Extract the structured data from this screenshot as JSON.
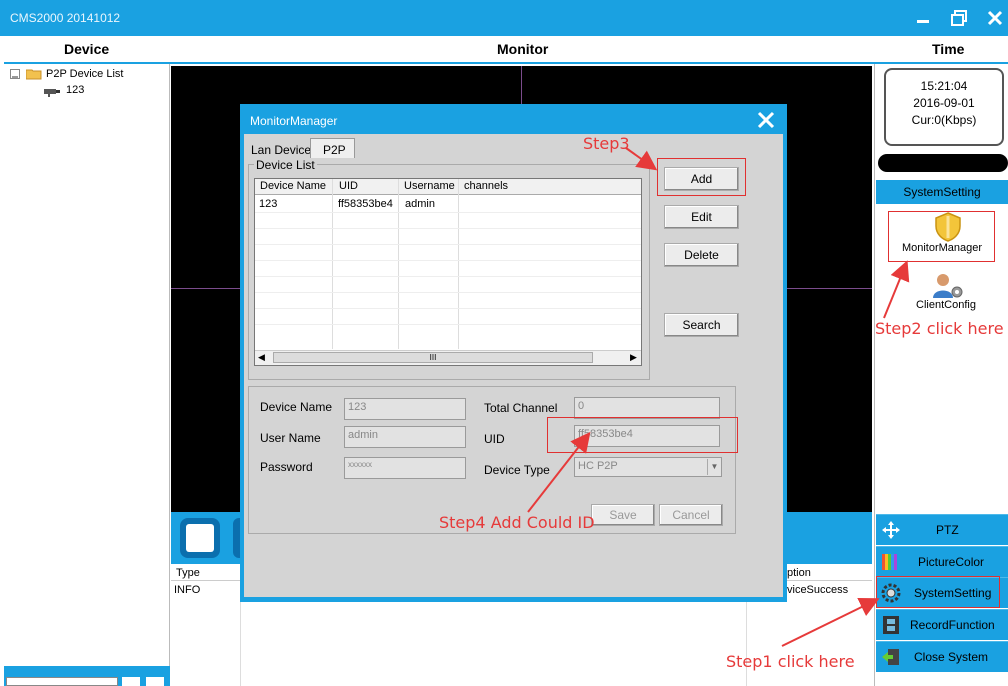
{
  "window": {
    "title": "CMS2000 20141012"
  },
  "columns": {
    "device": "Device",
    "monitor": "Monitor",
    "time": "Time"
  },
  "tree": {
    "root": "P2P Device List",
    "child": "123"
  },
  "time_panel": {
    "time": "15:21:04",
    "date": "2016-09-01",
    "rate": "Cur:0(Kbps)"
  },
  "right": {
    "system_setting_header": "SystemSetting",
    "monitor_manager": "MonitorManager",
    "client_config": "ClientConfig",
    "menu": [
      "PTZ",
      "PictureColor",
      "SystemSetting",
      "RecordFunction",
      "Close System"
    ]
  },
  "log": {
    "col_type": "Type",
    "col_description": "ption",
    "row_type": "INFO",
    "row_description": "viceSuccess"
  },
  "dialog": {
    "title": "MonitorManager",
    "tabs": [
      "Lan Device",
      "P2P"
    ],
    "group_label": "Device List",
    "table_headers": [
      "Device Name",
      "UID",
      "Username",
      "channels"
    ],
    "rows": [
      {
        "name": "123",
        "uid": "ff58353be4",
        "username": "admin",
        "channels": ""
      }
    ],
    "scroll_thumb": "III",
    "buttons": {
      "add": "Add",
      "edit": "Edit",
      "delete": "Delete",
      "search": "Search",
      "save": "Save",
      "cancel": "Cancel"
    },
    "form": {
      "device_name_label": "Device Name",
      "device_name": "123",
      "user_name_label": "User Name",
      "user_name": "admin",
      "password_label": "Password",
      "password": "xxxxxx",
      "total_channel_label": "Total Channel",
      "total_channel": "0",
      "uid_label": "UID",
      "uid": "ff58353be4",
      "device_type_label": "Device Type",
      "device_type": "HC P2P"
    }
  },
  "annotations": {
    "step1": "Step1 click here",
    "step2": "Step2 click here",
    "step3": "Step3",
    "step4": "Step4 Add Could ID",
    "color": "#e63a3a"
  },
  "colors": {
    "accent": "#1aa1e1",
    "black": "#000000"
  }
}
